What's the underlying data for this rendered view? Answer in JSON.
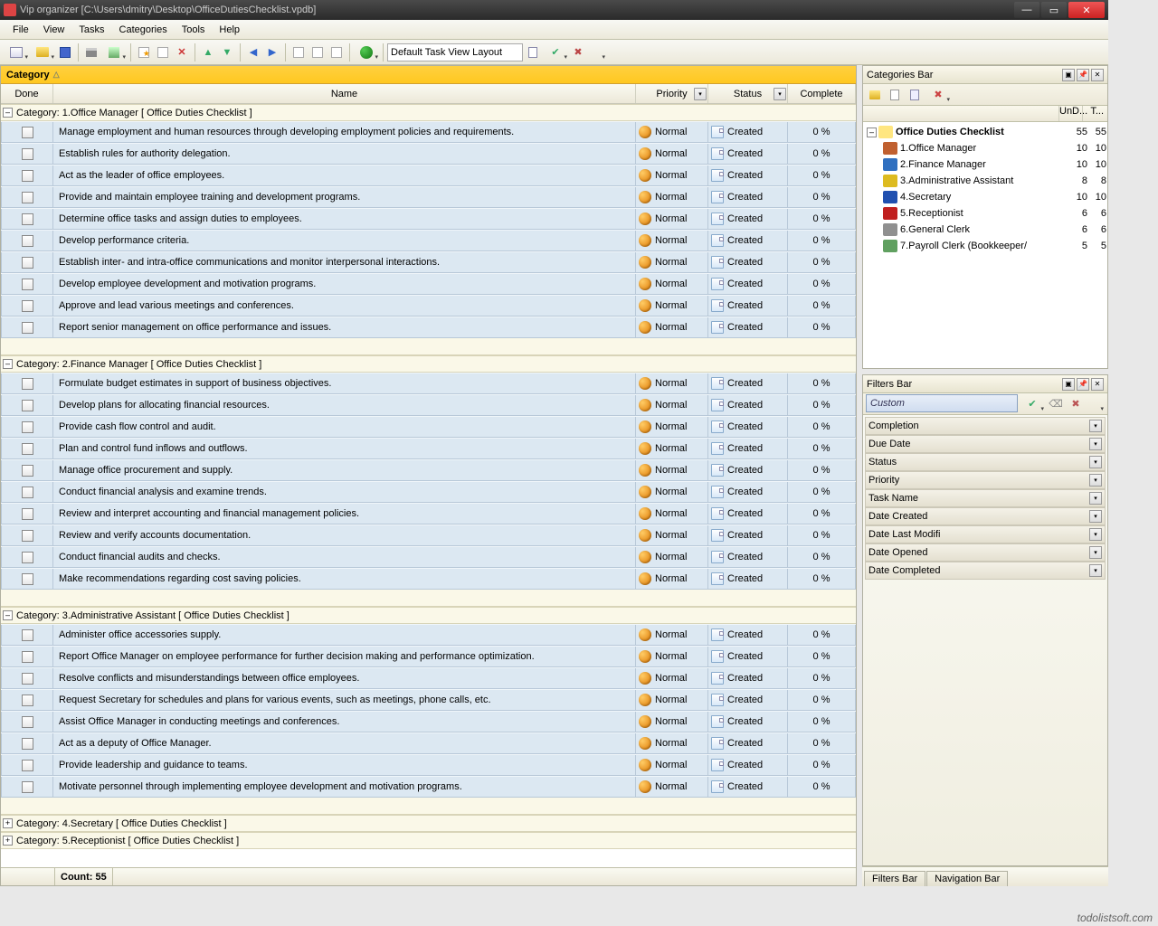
{
  "window": {
    "title": "Vip organizer [C:\\Users\\dmitry\\Desktop\\OfficeDutiesChecklist.vpdb]"
  },
  "menu": [
    "File",
    "View",
    "Tasks",
    "Categories",
    "Tools",
    "Help"
  ],
  "toolbar": {
    "layout_label": "Default Task View Layout"
  },
  "grid": {
    "group_by": "Category",
    "columns": {
      "done": "Done",
      "name": "Name",
      "priority": "Priority",
      "status": "Status",
      "complete": "Complete"
    },
    "groups": [
      {
        "expanded": true,
        "label": "Category: 1.Office Manager   [ Office Duties Checklist ]",
        "tasks": [
          {
            "name": "Manage employment and human resources through developing employment policies and requirements.",
            "priority": "Normal",
            "status": "Created",
            "complete": "0 %"
          },
          {
            "name": "Establish rules for authority delegation.",
            "priority": "Normal",
            "status": "Created",
            "complete": "0 %"
          },
          {
            "name": "Act as the leader of office employees.",
            "priority": "Normal",
            "status": "Created",
            "complete": "0 %"
          },
          {
            "name": "Provide and maintain employee training and development programs.",
            "priority": "Normal",
            "status": "Created",
            "complete": "0 %"
          },
          {
            "name": "Determine office tasks and assign duties to employees.",
            "priority": "Normal",
            "status": "Created",
            "complete": "0 %"
          },
          {
            "name": "Develop performance criteria.",
            "priority": "Normal",
            "status": "Created",
            "complete": "0 %"
          },
          {
            "name": "Establish inter- and intra-office communications and monitor interpersonal interactions.",
            "priority": "Normal",
            "status": "Created",
            "complete": "0 %"
          },
          {
            "name": "Develop employee development and motivation programs.",
            "priority": "Normal",
            "status": "Created",
            "complete": "0 %"
          },
          {
            "name": "Approve and lead various meetings and conferences.",
            "priority": "Normal",
            "status": "Created",
            "complete": "0 %"
          },
          {
            "name": "Report senior management on office performance and issues.",
            "priority": "Normal",
            "status": "Created",
            "complete": "0 %"
          }
        ]
      },
      {
        "expanded": true,
        "label": "Category: 2.Finance Manager   [ Office Duties Checklist ]",
        "tasks": [
          {
            "name": "Formulate budget estimates in support of business objectives.",
            "priority": "Normal",
            "status": "Created",
            "complete": "0 %"
          },
          {
            "name": "Develop plans for allocating financial resources.",
            "priority": "Normal",
            "status": "Created",
            "complete": "0 %"
          },
          {
            "name": "Provide cash flow control and audit.",
            "priority": "Normal",
            "status": "Created",
            "complete": "0 %"
          },
          {
            "name": "Plan and control fund inflows and outflows.",
            "priority": "Normal",
            "status": "Created",
            "complete": "0 %"
          },
          {
            "name": "Manage office procurement and supply.",
            "priority": "Normal",
            "status": "Created",
            "complete": "0 %"
          },
          {
            "name": "Conduct financial analysis and examine trends.",
            "priority": "Normal",
            "status": "Created",
            "complete": "0 %"
          },
          {
            "name": "Review and interpret accounting and financial management policies.",
            "priority": "Normal",
            "status": "Created",
            "complete": "0 %"
          },
          {
            "name": "Review and verify accounts documentation.",
            "priority": "Normal",
            "status": "Created",
            "complete": "0 %"
          },
          {
            "name": "Conduct financial audits and checks.",
            "priority": "Normal",
            "status": "Created",
            "complete": "0 %"
          },
          {
            "name": "Make recommendations regarding cost saving policies.",
            "priority": "Normal",
            "status": "Created",
            "complete": "0 %"
          }
        ]
      },
      {
        "expanded": true,
        "label": "Category: 3.Administrative Assistant   [ Office Duties Checklist ]",
        "tasks": [
          {
            "name": "Administer office accessories supply.",
            "priority": "Normal",
            "status": "Created",
            "complete": "0 %"
          },
          {
            "name": "Report Office Manager on employee performance for further decision making and performance optimization.",
            "priority": "Normal",
            "status": "Created",
            "complete": "0 %"
          },
          {
            "name": "Resolve conflicts and misunderstandings between office employees.",
            "priority": "Normal",
            "status": "Created",
            "complete": "0 %"
          },
          {
            "name": "Request Secretary for schedules and plans for various events, such as meetings, phone calls, etc.",
            "priority": "Normal",
            "status": "Created",
            "complete": "0 %"
          },
          {
            "name": "Assist Office Manager in conducting meetings and conferences.",
            "priority": "Normal",
            "status": "Created",
            "complete": "0 %"
          },
          {
            "name": "Act as a deputy of Office Manager.",
            "priority": "Normal",
            "status": "Created",
            "complete": "0 %"
          },
          {
            "name": "Provide leadership and guidance to teams.",
            "priority": "Normal",
            "status": "Created",
            "complete": "0 %"
          },
          {
            "name": "Motivate personnel through implementing employee development and motivation programs.",
            "priority": "Normal",
            "status": "Created",
            "complete": "0 %"
          }
        ]
      },
      {
        "expanded": false,
        "label": "Category: 4.Secretary   [ Office Duties Checklist ]",
        "tasks": []
      },
      {
        "expanded": false,
        "label": "Category: 5.Receptionist   [ Office Duties Checklist ]",
        "tasks": []
      }
    ]
  },
  "status": {
    "count_label": "Count:  55"
  },
  "categories_panel": {
    "title": "Categories Bar",
    "col1": "UnD...",
    "col2": "T...",
    "tree": [
      {
        "label": "Office Duties Checklist",
        "n1": "55",
        "n2": "55",
        "sel": true,
        "color": "#ffe680"
      },
      {
        "label": "1.Office Manager",
        "n1": "10",
        "n2": "10",
        "color": "#c06030"
      },
      {
        "label": "2.Finance Manager",
        "n1": "10",
        "n2": "10",
        "color": "#3070c0"
      },
      {
        "label": "3.Administrative Assistant",
        "n1": "8",
        "n2": "8",
        "color": "#ddbb20"
      },
      {
        "label": "4.Secretary",
        "n1": "10",
        "n2": "10",
        "color": "#2050b0"
      },
      {
        "label": "5.Receptionist",
        "n1": "6",
        "n2": "6",
        "color": "#c02020"
      },
      {
        "label": "6.General Clerk",
        "n1": "6",
        "n2": "6",
        "color": "#909090"
      },
      {
        "label": "7.Payroll Clerk (Bookkeeper/",
        "n1": "5",
        "n2": "5",
        "color": "#60a060"
      }
    ]
  },
  "filters_panel": {
    "title": "Filters Bar",
    "preset": "Custom",
    "rows": [
      "Completion",
      "Due Date",
      "Status",
      "Priority",
      "Task Name",
      "Date Created",
      "Date Last Modifi",
      "Date Opened",
      "Date Completed"
    ]
  },
  "bottom_tabs": [
    "Filters Bar",
    "Navigation Bar"
  ],
  "watermark": "todolistsoft.com"
}
